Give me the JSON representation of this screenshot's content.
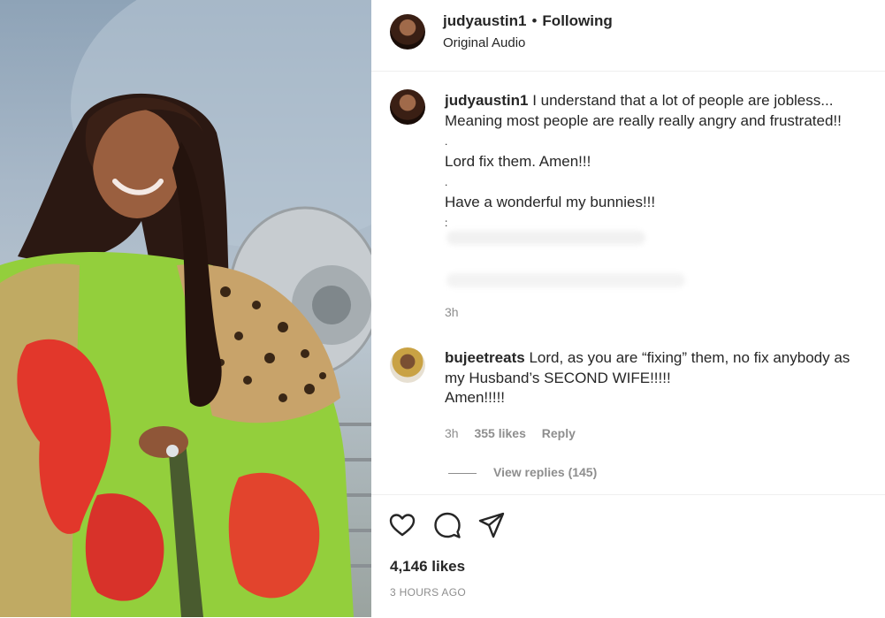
{
  "post": {
    "author": "judyaustin1",
    "separator": "•",
    "follow_status": "Following",
    "audio": "Original Audio"
  },
  "caption": {
    "username": "judyaustin1",
    "line1": "I understand that a lot of people are jobless...",
    "line2": "Meaning most people are really really angry and frustrated!!",
    "line3": ".",
    "line4": "Lord fix them. Amen!!!",
    "line5": ".",
    "line6": "Have a wonderful my bunnies!!!",
    "line7": ":",
    "time": "3h"
  },
  "comment": {
    "username": "bujeetreats",
    "line1": "Lord, as you are “fixing” them, no fix anybody as",
    "line2": "my Husband’s SECOND WIFE!!!!!",
    "line3": "Amen!!!!!",
    "time": "3h",
    "likes": "355 likes",
    "reply": "Reply",
    "view_replies": "View replies (145)"
  },
  "footer": {
    "likes": "4,146 likes",
    "timestamp": "3 HOURS AGO"
  }
}
